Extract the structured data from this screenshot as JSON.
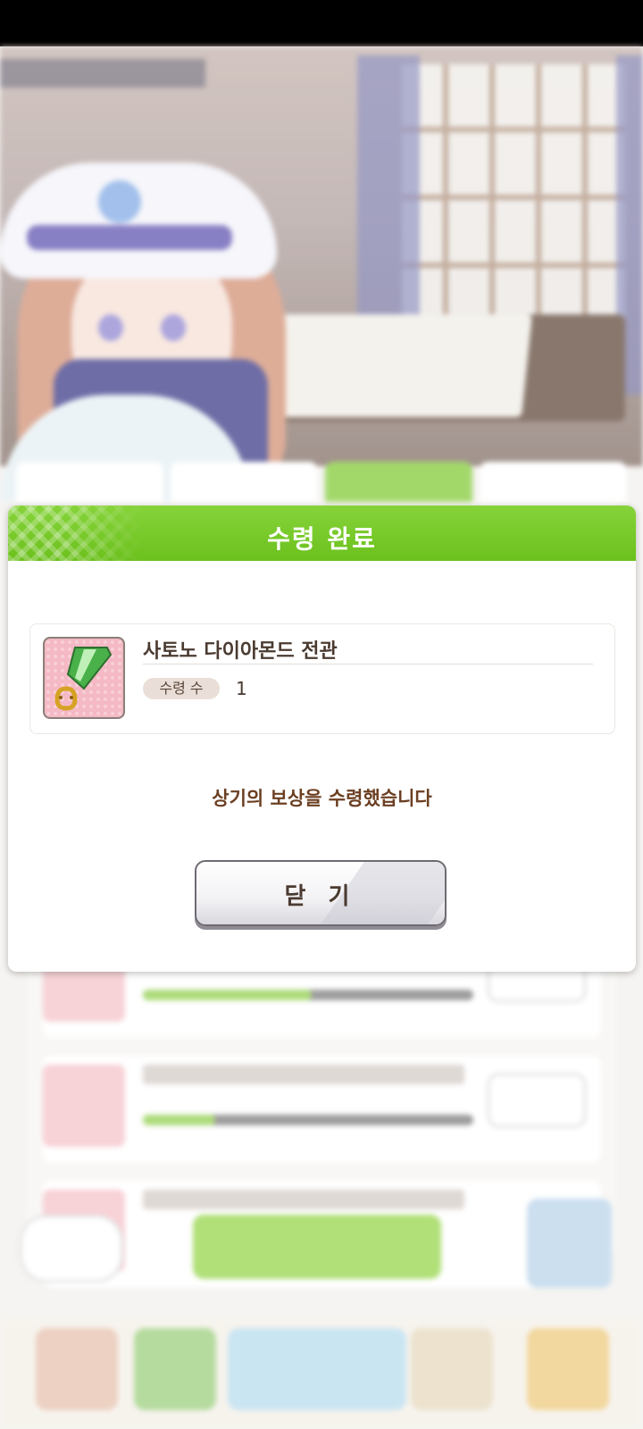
{
  "dialog": {
    "title": "수령 완료",
    "reward": {
      "name": "사토노 다이아몬드 전관",
      "count_label": "수령 수",
      "count": "1",
      "icon": "medal-ribbon-horseshoe-icon"
    },
    "message": "상기의 보상을 수령했습니다",
    "close_label": "닫 기"
  },
  "background": {
    "tabs_active_index": 2,
    "rows_progress": [
      0.51,
      0.22
    ]
  },
  "colors": {
    "header_green": "#7acb2c",
    "message_brown": "#6b3f22",
    "text_dark": "#4a3a30"
  }
}
